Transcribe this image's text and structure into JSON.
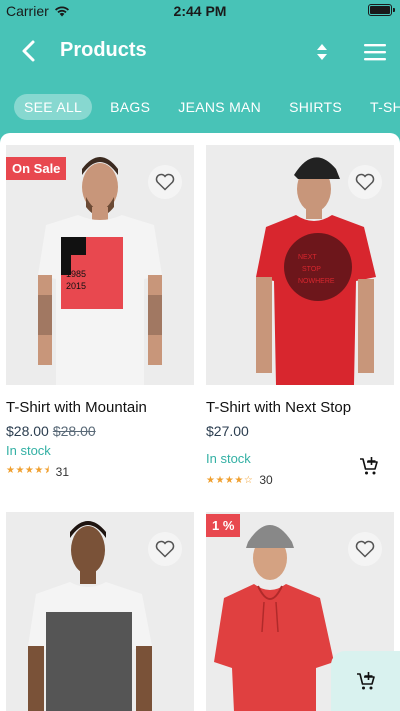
{
  "status": {
    "carrier": "Carrier",
    "time": "2:44 PM",
    "battery_level": 1.0
  },
  "nav": {
    "title": "Products"
  },
  "categories": [
    "SEE ALL",
    "BAGS",
    "JEANS MAN",
    "SHIRTS",
    "T-SHIRTS"
  ],
  "active_category": "SEE ALL",
  "products": [
    {
      "name": "T-Shirt with Mountain",
      "price": "$28.00",
      "old_price": "$28.00",
      "stock": "In stock",
      "rating": 4.5,
      "reviews": "31",
      "badge": "On Sale",
      "shirt_color": "#f4f4f4"
    },
    {
      "name": "T-Shirt with Next Stop",
      "price": "$27.00",
      "old_price": "",
      "stock": "In stock",
      "rating": 4,
      "reviews": "30",
      "badge": "",
      "shirt_color": "#d8262e"
    },
    {
      "name": "",
      "badge": "",
      "shirt_color": "#555555"
    },
    {
      "name": "",
      "badge": "1 %",
      "shirt_color": "#e04040"
    }
  ],
  "colors": {
    "primary": "#48c3b7",
    "badge": "#e8484f",
    "stock": "#33b0a4",
    "star": "#f0a030"
  }
}
